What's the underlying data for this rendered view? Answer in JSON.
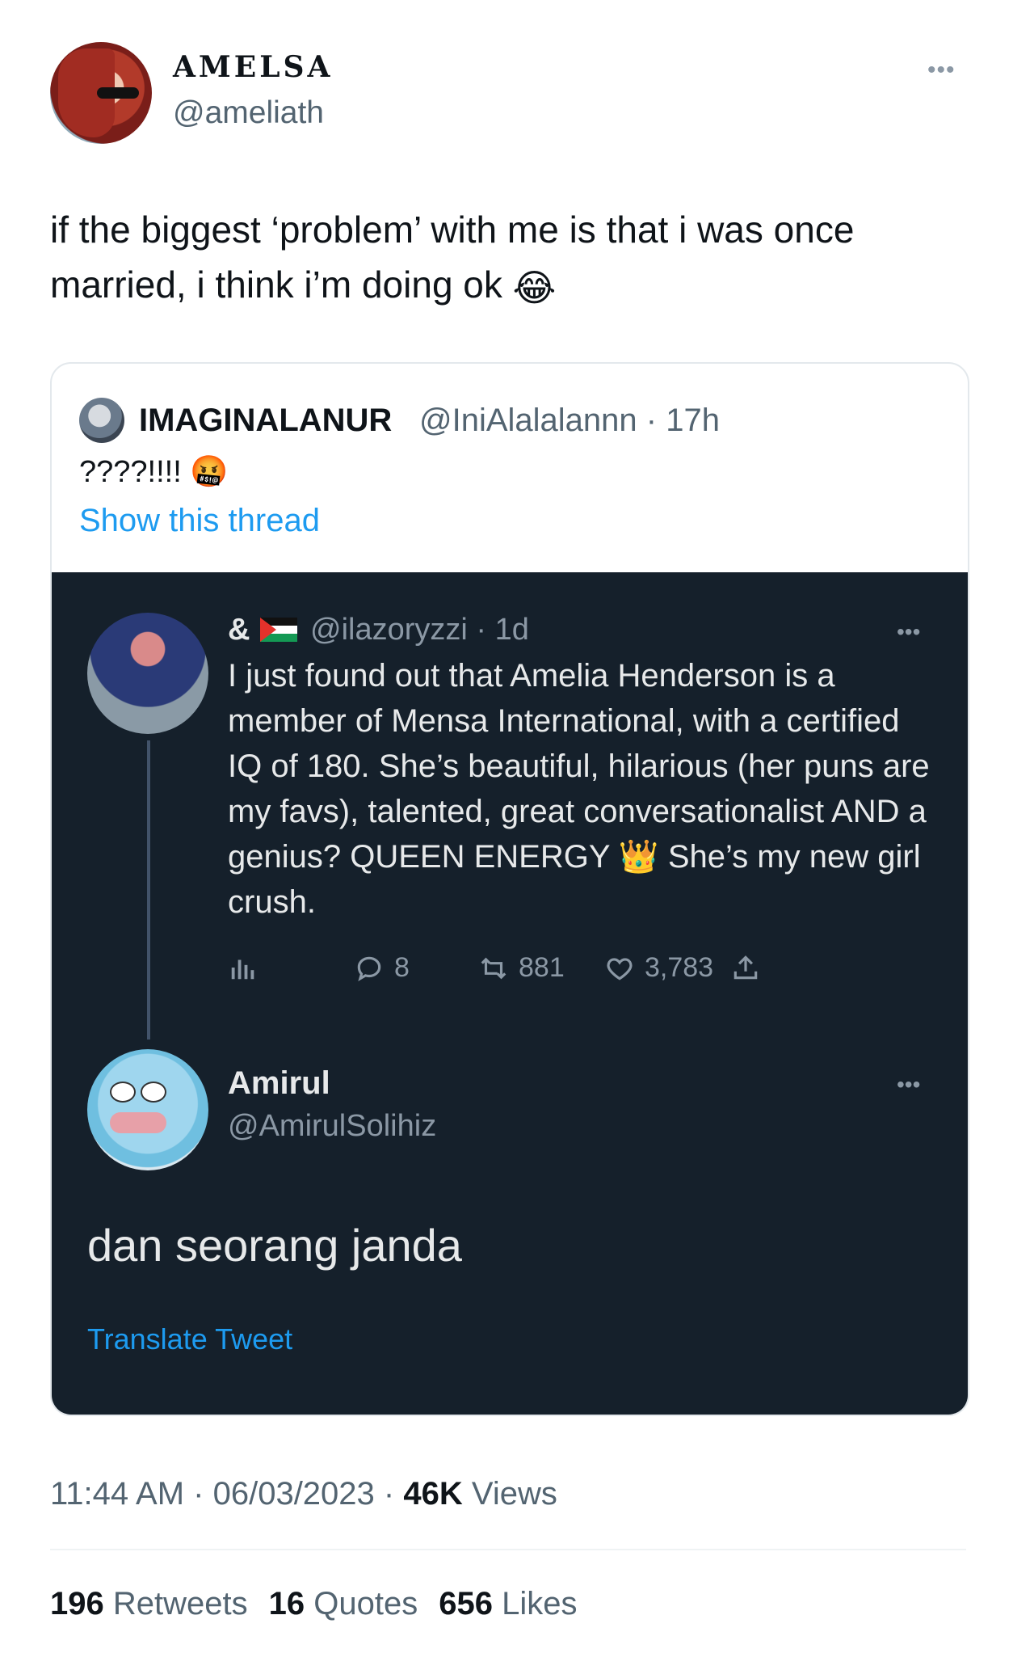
{
  "main_tweet": {
    "display_name": "ᗩᗰᗴᒪᏚᗩ",
    "display_name_style": "AMELSA",
    "handle": "@ameliath",
    "more": "•••",
    "text": "if the biggest ‘problem’ with me is that i was once married, i think i’m doing ok",
    "emoji": "😂"
  },
  "quote": {
    "name": "IMAGINALANUR",
    "handle": "@IniAlalalannn · 17h",
    "text": "????!!!!",
    "emoji": "🤬",
    "show_thread": "Show this thread"
  },
  "embedded": {
    "reply1": {
      "name": "&",
      "handle": "@ilazoryzzi · 1d",
      "more": "•••",
      "text_before": "I just found out that Amelia Henderson is a member of Mensa International, with a certified IQ of 180. She’s beautiful, hilarious (her puns are my favs), talented, great conversationalist AND a genius? QUEEN ENERGY",
      "crown": "👑",
      "text_after": "She’s my new girl crush.",
      "actions": {
        "replies": "8",
        "retweets": "881",
        "likes": "3,783"
      }
    },
    "reply2": {
      "name": "Amirul",
      "handle": "@AmirulSolihiz",
      "more": "•••",
      "text": "dan seorang janda",
      "translate": "Translate Tweet"
    }
  },
  "footer": {
    "time": "11:44 AM",
    "date": "06/03/2023",
    "views_count": "46K",
    "views_label": "Views",
    "retweets_count": "196",
    "retweets_label": "Retweets",
    "quotes_count": "16",
    "quotes_label": "Quotes",
    "likes_count": "656",
    "likes_label": "Likes"
  },
  "colors": {
    "link": "#1d9bf0",
    "dark_bg": "#15202b",
    "muted": "#536471"
  }
}
